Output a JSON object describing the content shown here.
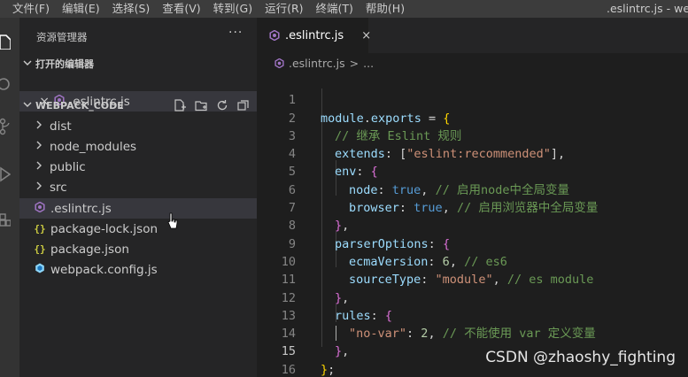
{
  "menubar": {
    "items": [
      "文件(F)",
      "编辑(E)",
      "选择(S)",
      "查看(V)",
      "转到(G)",
      "运行(R)",
      "终端(T)",
      "帮助(H)"
    ],
    "window_title": ".eslintrc.js - webpack"
  },
  "activitybar": {
    "icons": [
      "files-icon",
      "search-icon",
      "source-control-icon",
      "run-debug-icon",
      "extensions-icon"
    ]
  },
  "sidebar": {
    "title": "资源管理器",
    "more": "···",
    "open_editors": {
      "label": "打开的编辑器",
      "items": [
        {
          "name": ".eslintrc.js",
          "close": "×"
        }
      ]
    },
    "project": {
      "label": "WEBPACK_CODE",
      "folders": [
        "dist",
        "node_modules",
        "public",
        "src"
      ],
      "files": [
        {
          "name": ".eslintrc.js",
          "icon": "eslint-icon"
        },
        {
          "name": "package-lock.json",
          "icon": "json-icon"
        },
        {
          "name": "package.json",
          "icon": "json-icon"
        },
        {
          "name": "webpack.config.js",
          "icon": "webpack-icon"
        }
      ]
    }
  },
  "editor": {
    "tab": {
      "label": ".eslintrc.js",
      "close": "×"
    },
    "breadcrumb": {
      "file": ".eslintrc.js",
      "sep": ">",
      "rest": "..."
    },
    "line_numbers": [
      "1",
      "2",
      "3",
      "4",
      "5",
      "6",
      "7",
      "8",
      "9",
      "10",
      "11",
      "12",
      "13",
      "14",
      "15",
      "16"
    ],
    "active_line": "15",
    "lines": {
      "l1_a": "module",
      "l1_b": ".",
      "l1_c": "exports",
      "l1_d": " = ",
      "l1_e": "{",
      "l2": "// 继承 Eslint 规则",
      "l3_a": "extends",
      "l3_b": ": [",
      "l3_c": "\"eslint:recommended\"",
      "l3_d": "],",
      "l4_a": "env",
      "l4_b": ": ",
      "l4_c": "{",
      "l5_a": "node",
      "l5_b": ": ",
      "l5_c": "true",
      "l5_d": ", ",
      "l5_e": "// 启用node中全局变量",
      "l6_a": "browser",
      "l6_b": ": ",
      "l6_c": "true",
      "l6_d": ", ",
      "l6_e": "// 启用浏览器中全局变量",
      "l7_a": "}",
      "l7_b": ",",
      "l8_a": "parserOptions",
      "l8_b": ": ",
      "l8_c": "{",
      "l9_a": "ecmaVersion",
      "l9_b": ": ",
      "l9_c": "6",
      "l9_d": ", ",
      "l9_e": "// es6",
      "l10_a": "sourceType",
      "l10_b": ": ",
      "l10_c": "\"module\"",
      "l10_d": ", ",
      "l10_e": "// es module",
      "l11_a": "}",
      "l11_b": ",",
      "l12_a": "rules",
      "l12_b": ": ",
      "l12_c": "{",
      "l13_a": "\"no-var\"",
      "l13_b": ": ",
      "l13_c": "2",
      "l13_d": ", ",
      "l13_e": "// 不能使用 var 定义变量",
      "l14_a": "}",
      "l14_b": ",",
      "l15_a": "}",
      "l15_b": ";"
    }
  },
  "watermark": "CSDN @zhaoshy_fighting",
  "colors": {
    "accent_eslint": "#a074c4",
    "json_icon": "#cbcb41",
    "webpack_icon": "#8dd6f9",
    "comment": "#6a9955",
    "string": "#ce9178",
    "keyword": "#569cd6"
  }
}
